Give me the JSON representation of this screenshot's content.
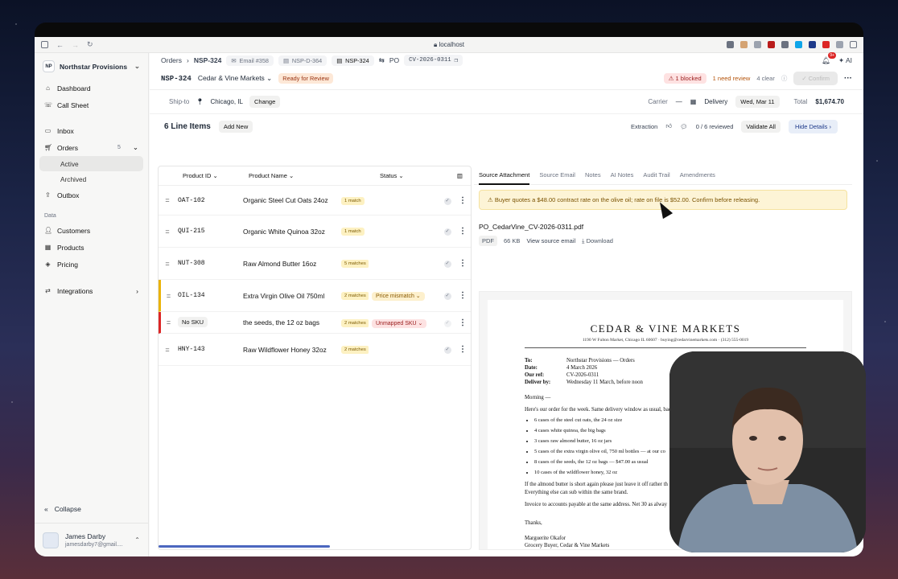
{
  "browser": {
    "url": "localhost",
    "ai_label": "AI",
    "notif_count": "9+"
  },
  "org": {
    "initials": "NP",
    "name": "Northstar Provisions"
  },
  "nav": {
    "dashboard": "Dashboard",
    "call_sheet": "Call Sheet",
    "inbox": "Inbox",
    "orders": "Orders",
    "orders_count": "5",
    "active": "Active",
    "archived": "Archived",
    "outbox": "Outbox",
    "data_section": "Data",
    "customers": "Customers",
    "products": "Products",
    "pricing": "Pricing",
    "integrations": "Integrations",
    "collapse": "Collapse"
  },
  "user": {
    "name": "James Darby",
    "email": "jamesdarby7@gmail...."
  },
  "crumbs": {
    "orders": "Orders",
    "current": "NSP-324",
    "email": "Email #358",
    "doc1": "NSP-D-364",
    "doc2": "NSP-324",
    "po_label": "PO",
    "po": "CV-2026-0311"
  },
  "header": {
    "id": "NSP-324",
    "customer": "Cedar & Vine Markets",
    "status": "Ready for Review",
    "blocked": "1 blocked",
    "need_review": "1 need review",
    "clear": "4 clear",
    "confirm": "Confirm"
  },
  "ship": {
    "label": "Ship-to",
    "city": "Chicago, IL",
    "change": "Change",
    "carrier_label": "Carrier",
    "carrier": "—",
    "delivery_label": "Delivery",
    "delivery": "Wed, Mar 11",
    "total_label": "Total",
    "total": "$1,674.70"
  },
  "lines": {
    "title": "6 Line Items",
    "add": "Add New",
    "extraction": "Extraction",
    "reviewed": "0 / 6 reviewed",
    "validate": "Validate All",
    "hide": "Hide Details"
  },
  "table": {
    "col_id": "Product ID",
    "col_name": "Product Name",
    "col_status": "Status"
  },
  "rows": [
    {
      "id": "OAT-102",
      "name": "Organic Steel Cut Oats 24oz",
      "matches": "1 match",
      "status": ""
    },
    {
      "id": "QUI-215",
      "name": "Organic White Quinoa 32oz",
      "matches": "1 match",
      "status": ""
    },
    {
      "id": "NUT-308",
      "name": "Raw Almond Butter 16oz",
      "matches": "5 matches",
      "status": ""
    },
    {
      "id": "OIL-134",
      "name": "Extra Virgin Olive Oil 750ml",
      "matches": "2 matches",
      "status": "Price mismatch"
    },
    {
      "id": "No SKU",
      "name": "the seeds, the 12 oz bags",
      "matches": "2 matches",
      "status": "Unmapped SKU"
    },
    {
      "id": "HNY-143",
      "name": "Raw Wildflower Honey 32oz",
      "matches": "2 matches",
      "status": ""
    }
  ],
  "tabs": [
    "Source Attachment",
    "Source Email",
    "Notes",
    "AI Notes",
    "Audit Trail",
    "Amendments"
  ],
  "alert": "Buyer quotes a $48.00 contract rate on the olive oil; rate on file is $52.00. Confirm before releasing.",
  "file": {
    "name": "PO_CedarVine_CV-2026-0311.pdf",
    "type": "PDF",
    "size": "66 KB",
    "view": "View source email",
    "download": "Download"
  },
  "doc": {
    "title": "CEDAR & VINE MARKETS",
    "address": "1190 W Fulton Market, Chicago IL 60607  ·  buying@cedarvinemarkets.com  ·  (312) 555-0019",
    "to_k": "To:",
    "to": "Northstar Provisions — Orders",
    "date_k": "Date:",
    "date": "4 March 2026",
    "ref_k": "Our ref:",
    "ref": "CV-2026-0311",
    "by_k": "Deliver by:",
    "by": "Wednesday 11 March, before noon",
    "greet": "Morning —",
    "intro": "Here's our order for the week. Same delivery window as usual, back entrance",
    "items": [
      "6 cases of the steel cut oats, the 24 oz size",
      "4 cases white quinoa, the big bags",
      "3 cases raw almond butter, 16 oz jars",
      "5 cases of the extra virgin olive oil, 750 ml bottles — at our co",
      "8 cases of the seeds, the 12 oz bags — $47.00 as usual",
      "10 cases of the wildflower honey, 32 oz"
    ],
    "p1": "If the almond butter is short again please just leave it off rather th",
    "p2": "Everything else can sub within the same brand.",
    "p3": "Invoice to accounts payable at the same address. Net 30 as alway",
    "thanks": "Thanks,",
    "sig1": "Marguerite Okafor",
    "sig2": "Grocery Buyer, Cedar & Vine Markets"
  }
}
